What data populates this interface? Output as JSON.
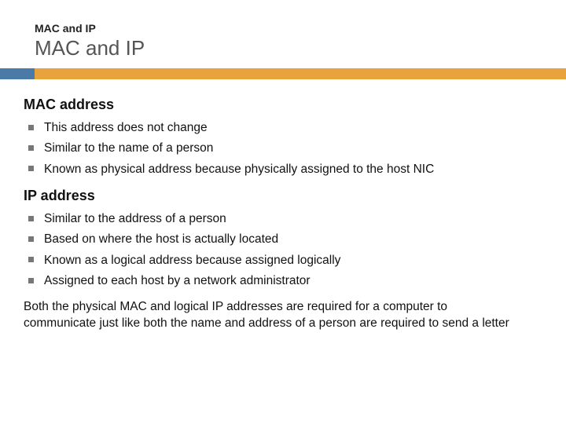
{
  "header": {
    "breadcrumb": "MAC and IP",
    "title": "MAC and IP"
  },
  "section1": {
    "heading": "MAC address",
    "items": [
      "This address does not change",
      "Similar to the name of a person",
      "Known as physical address because physically assigned to the host NIC"
    ]
  },
  "section2": {
    "heading": "IP address",
    "items": [
      "Similar to the address of a person",
      "Based on where the host is actually located",
      "Known as a logical address because assigned logically",
      "Assigned to each host by a network administrator"
    ]
  },
  "footer": "Both the physical MAC and logical IP addresses are required for a computer to communicate just like both the name and address of a person are required to send a letter"
}
